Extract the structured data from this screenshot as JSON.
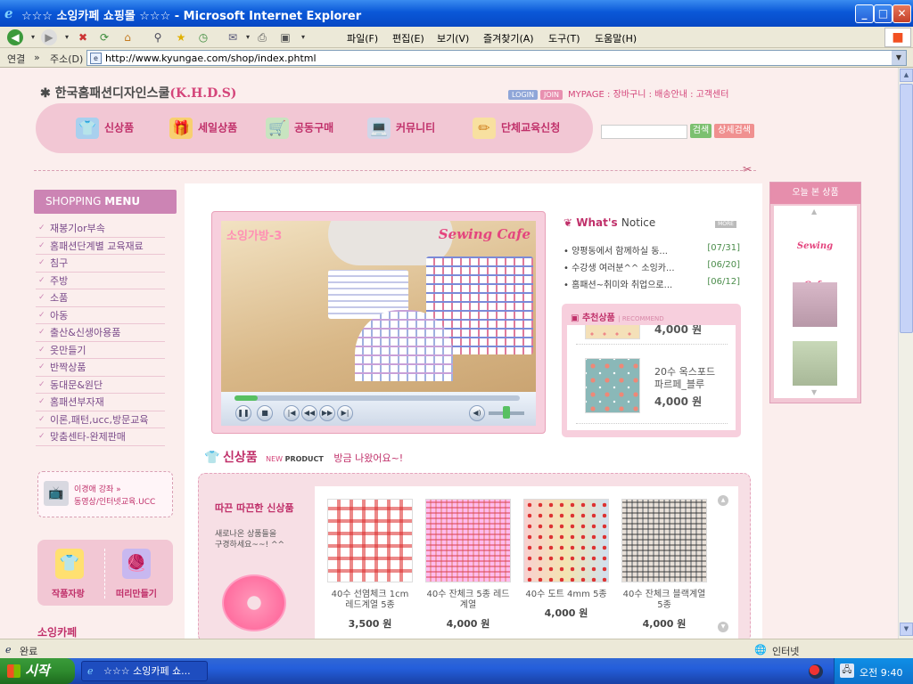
{
  "window": {
    "title": "☆☆☆ 소잉카페 쇼핑몰 ☆☆☆ - Microsoft Internet Explorer",
    "min": "_",
    "max": "□",
    "close": "✕"
  },
  "menubar": [
    "파일(F)",
    "편집(E)",
    "보기(V)",
    "즐겨찾기(A)",
    "도구(T)",
    "도움말(H)"
  ],
  "addressbar": {
    "links_label": "연결",
    "chevron": "»",
    "address_label": "주소(D)",
    "url": "http://www.kyungae.com/shop/index.phtml"
  },
  "site": {
    "logo_prefix": "✱ 한국홈패션디자인스쿨",
    "logo_abbr": "(K.H.D.S)",
    "login": "LOGIN",
    "join": "JOIN",
    "links": "MYPAGE : 장바구니 : 배송안내 : 고객센터",
    "nav": [
      "신상품",
      "세일상품",
      "공동구매",
      "커뮤니티",
      "단체교육신청"
    ],
    "search_btn": "검색",
    "detail_search_btn": "상세검색"
  },
  "sidebar": {
    "title_a": "SHOPPING",
    "title_b": "MENU",
    "items": [
      "재봉기or부속",
      "홈패션단계별 교육재료",
      "침구",
      "주방",
      "소품",
      "아동",
      "출산&신생아용품",
      "옷만들기",
      "반짝상품",
      "동대문&원단",
      "홈패션부자재",
      "이론,패턴,ucc,방문교육",
      "맞춤센타-완제판매"
    ],
    "ucc_line1": "이경애 강좌 »",
    "ucc_line2": "동영상/인터넷교육.UCC",
    "gallery": "작품자랑",
    "rummage": "떠리만들기",
    "peek": "소잉카페"
  },
  "video": {
    "caption": "소잉가방-3",
    "brand": "Sewing Cafe",
    "progress": 0.08
  },
  "notice": {
    "title_a": "What's",
    "title_b": "Notice",
    "more": "MORE",
    "rows": [
      {
        "text": "양평동에서 함께하실 동...",
        "date": "[07/31]"
      },
      {
        "text": "수강생 여러분^^ 소잉카...",
        "date": "[06/20]"
      },
      {
        "text": "홈패션~취미와 취업으로...",
        "date": "[06/12]"
      }
    ]
  },
  "recommend": {
    "title": "추천상품",
    "sub": "| RECOMMEND",
    "prev_price": "4,000 원",
    "name_line1": "20수 옥스포드",
    "name_line2": "파르페_블루",
    "price": "4,000 원"
  },
  "new_products": {
    "title": "신상품",
    "tag_a": "NEW",
    "tag_b": "PRODUCT",
    "msg": "방금 나왔어요~!",
    "left_title": "따끈 따끈한 신상품",
    "left_sub_1": "새로나온 상품들을",
    "left_sub_2": "구경하세요~~! ^^",
    "items": [
      {
        "name": "40수 선염체크 1cm 레드계열 5종",
        "price": "3,500 원"
      },
      {
        "name": "40수 잔체크 5종 레드계열",
        "price": "4,000 원"
      },
      {
        "name": "40수 도트 4mm 5종",
        "price": "4,000 원"
      },
      {
        "name": "40수 잔체크 블랙계열 5종",
        "price": "4,000 원"
      }
    ]
  },
  "recent": {
    "title": "오늘 본 상품",
    "logo_text": "Sewing Cafe"
  },
  "status": {
    "done": "완료",
    "zone": "인터넷"
  },
  "taskbar": {
    "start": "시작",
    "item": "☆☆☆ 소잉카페 쇼...",
    "clock": "오전 9:40"
  }
}
